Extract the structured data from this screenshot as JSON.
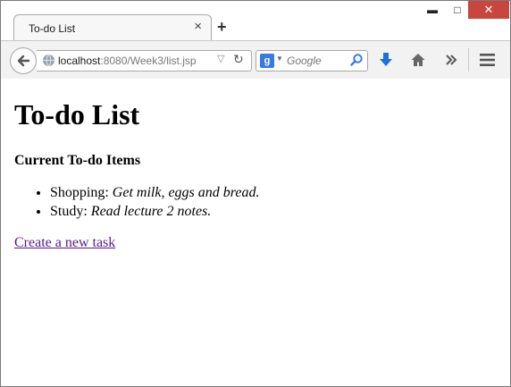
{
  "browser": {
    "tab_title": "To-do List",
    "tab_close": "×",
    "new_tab": "+",
    "window_controls": {
      "minimize": "▬",
      "maximize": "□",
      "close": "✕"
    },
    "url_host": "localhost",
    "url_rest": ":8080/Week3/list.jsp",
    "search_engine": "g",
    "search_placeholder": "Google",
    "icons": [
      "back-arrow-icon",
      "globe-icon",
      "dropdown-arrow-icon",
      "reload-icon",
      "google-icon",
      "search-icon",
      "download-icon",
      "home-icon",
      "overflow-chevron-icon",
      "menu-icon"
    ]
  },
  "page": {
    "heading": "To-do List",
    "subheading": "Current To-do Items",
    "items": [
      {
        "label": "Shopping:",
        "note": "Get milk, eggs and bread."
      },
      {
        "label": "Study:",
        "note": "Read lecture 2 notes."
      }
    ],
    "link_text": "Create a new task"
  },
  "colors": {
    "link_visited": "#551a8b",
    "close_button": "#c7463d",
    "download_blue": "#1a73d9"
  }
}
